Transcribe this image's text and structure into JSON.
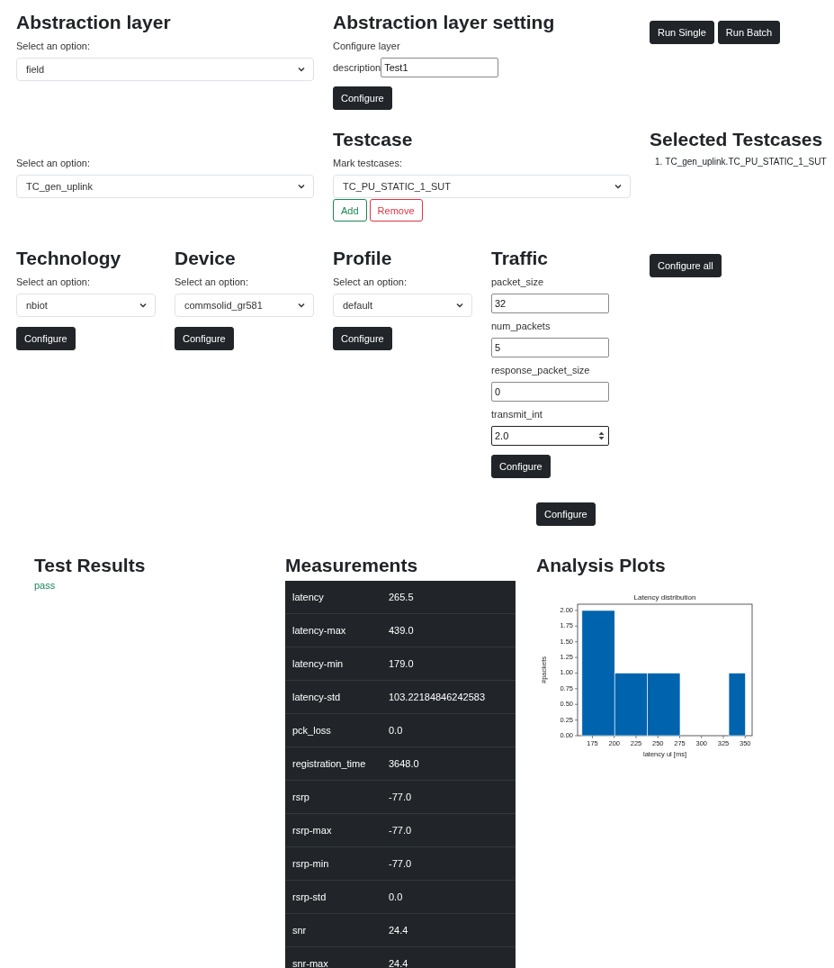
{
  "abstraction_layer": {
    "title": "Abstraction layer",
    "label": "Select an option:",
    "value": "field"
  },
  "abstraction_setting": {
    "title": "Abstraction layer setting",
    "subtitle": "Configure layer",
    "field_label": "description",
    "field_value": "Test1",
    "button": "Configure"
  },
  "run_buttons": [
    "Run Single",
    "Run Batch"
  ],
  "testcase_module": {
    "label": "Select an option:",
    "value": "TC_gen_uplink"
  },
  "testcase": {
    "title": "Testcase",
    "label": "Mark testcases:",
    "value": "TC_PU_STATIC_1_SUT",
    "buttons": [
      {
        "label": "Add",
        "kind": "add"
      },
      {
        "label": "Remove",
        "kind": "remove"
      }
    ]
  },
  "selected_testcases": {
    "title": "Selected Testcases",
    "items": [
      {
        "number": "1.",
        "text": "TC_gen_uplink.TC_PU_STATIC_1_SUT"
      }
    ]
  },
  "configs": [
    {
      "title": "Technology",
      "label": "Select an option:",
      "value": "nbiot",
      "button": "Configure"
    },
    {
      "title": "Device",
      "label": "Select an option:",
      "value": "commsolid_gr581",
      "button": "Configure"
    },
    {
      "title": "Profile",
      "label": "Select an option:",
      "value": "default",
      "button": "Configure"
    }
  ],
  "traffic": {
    "title": "Traffic",
    "fields": [
      {
        "label": "packet_size",
        "value": "32",
        "kind": "text"
      },
      {
        "label": "num_packets",
        "value": "5",
        "kind": "text"
      },
      {
        "label": "response_packet_size",
        "value": "0",
        "kind": "text"
      },
      {
        "label": "transmit_int",
        "value": "2.0",
        "kind": "number"
      }
    ],
    "button": "Configure"
  },
  "configure_all_button": "Configure all",
  "configure_button": "Configure",
  "test_results": {
    "title": "Test Results",
    "result": "pass",
    "kind": "pass"
  },
  "measurements": {
    "title": "Measurements",
    "rows": [
      {
        "name": "latency",
        "value": "265.5"
      },
      {
        "name": "latency-max",
        "value": "439.0"
      },
      {
        "name": "latency-min",
        "value": "179.0"
      },
      {
        "name": "latency-std",
        "value": "103.22184846242583"
      },
      {
        "name": "pck_loss",
        "value": "0.0"
      },
      {
        "name": "registration_time",
        "value": "3648.0"
      },
      {
        "name": "rsrp",
        "value": "-77.0"
      },
      {
        "name": "rsrp-max",
        "value": "-77.0"
      },
      {
        "name": "rsrp-min",
        "value": "-77.0"
      },
      {
        "name": "rsrp-std",
        "value": "0.0"
      },
      {
        "name": "snr",
        "value": "24.4"
      },
      {
        "name": "snr-max",
        "value": "24.4"
      }
    ]
  },
  "analysis": {
    "title": "Analysis Plots",
    "chart_data": {
      "type": "bar",
      "title": "Latency distribution",
      "xlabel": "latency ul [ms]",
      "ylabel": "#packets",
      "x": [
        181.75,
        219.25,
        256.75,
        340.75
      ],
      "series": [
        {
          "color": "#0063ad",
          "values": [
            2,
            1,
            1,
            1
          ]
        }
      ],
      "xlim": [
        158,
        358
      ],
      "ylim": [
        0,
        2.1
      ],
      "xticks": [
        175,
        200,
        225,
        250,
        275,
        300,
        325,
        350
      ],
      "yticks": [
        {
          "value": 0,
          "label": "0.00"
        },
        {
          "value": 0.25,
          "label": "0.25"
        },
        {
          "value": 0.5,
          "label": "0.50"
        },
        {
          "value": 0.75,
          "label": "0.75"
        },
        {
          "value": 1,
          "label": "1.00"
        },
        {
          "value": 1.25,
          "label": "1.25"
        },
        {
          "value": 1.5,
          "label": "1.50"
        },
        {
          "value": 1.75,
          "label": "1.75"
        },
        {
          "value": 2,
          "label": "2.00"
        }
      ]
    }
  }
}
